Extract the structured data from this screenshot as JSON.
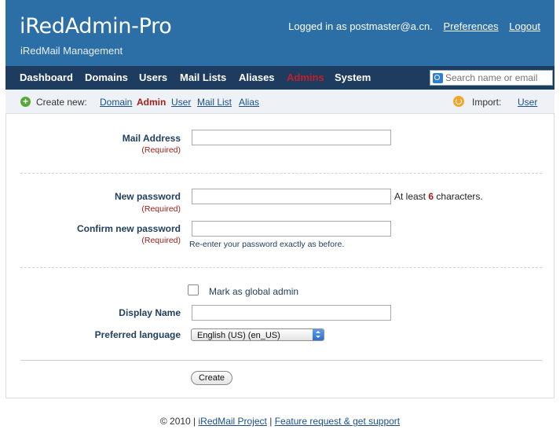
{
  "header": {
    "title": "iRedAdmin-Pro",
    "subtitle": "iRedMail Management",
    "logged_in_text": "Logged in as postmaster@a.cn.",
    "preferences_label": "Preferences",
    "logout_label": "Logout"
  },
  "nav": {
    "items": [
      "Dashboard",
      "Domains",
      "Users",
      "Mail Lists",
      "Aliases",
      "Admins",
      "System"
    ],
    "active": "Admins",
    "search_placeholder": "Search name or email"
  },
  "subnav": {
    "create_label": "Create new:",
    "create_items": [
      "Domain",
      "Admin",
      "User",
      "Mail List",
      "Alias"
    ],
    "create_current": "Admin",
    "import_label": "Import:",
    "import_item": "User"
  },
  "form": {
    "mail_address_label": "Mail Address",
    "required_text": "(Required)",
    "new_password_label": "New password",
    "password_hint_prefix": "At least",
    "password_min": "6",
    "password_hint_suffix": "characters.",
    "confirm_password_label": "Confirm new password",
    "confirm_hint": "Re-enter your password exactly as before.",
    "global_admin_label": "Mark as global admin",
    "display_name_label": "Display Name",
    "preferred_language_label": "Preferred language",
    "preferred_language_value": "English (US) (en_US)",
    "create_button": "Create"
  },
  "footer": {
    "copyright": "© 2010 |",
    "project_link": "iRedMail Project",
    "separator": "|",
    "support_link": "Feature request & get support"
  },
  "colors": {
    "header_bg": "#2c6ea6",
    "nav_bg": "#1d3c5f",
    "active_nav": "#c0202a",
    "required": "#a0201c"
  }
}
